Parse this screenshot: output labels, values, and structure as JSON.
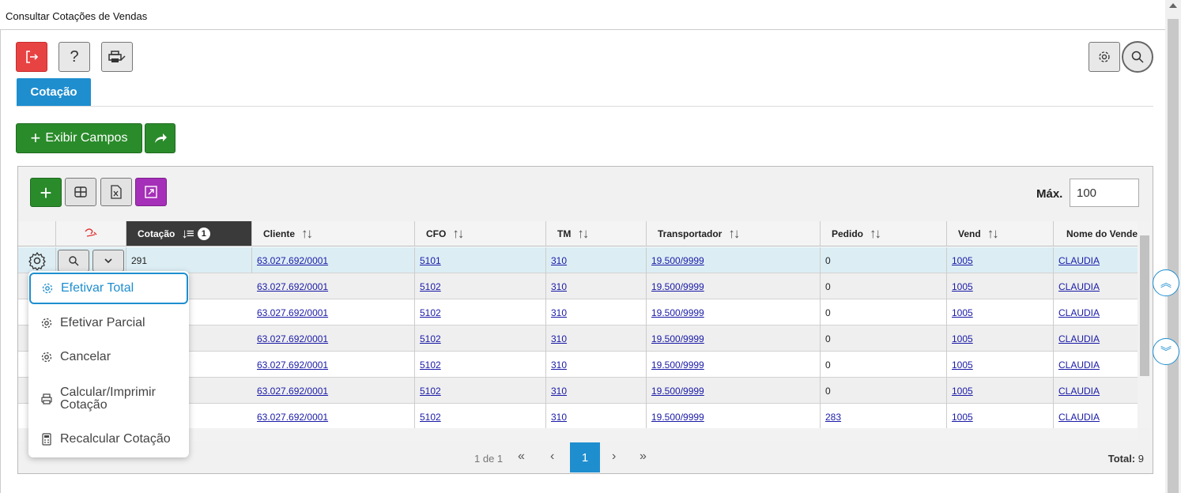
{
  "window": {
    "title": "Consultar Cotações de Vendas"
  },
  "toolbar": {
    "exit_icon": "logout-icon",
    "help_label": "?",
    "print_icon": "printer-icon",
    "settings_icon": "gear-icon",
    "search_icon": "search-icon"
  },
  "tabs": [
    {
      "label": "Cotação"
    }
  ],
  "actions": {
    "exibir_campos_label": "Exibir Campos",
    "share_icon": "share-icon"
  },
  "grid_toolbar": {
    "add_icon": "plus-icon",
    "columns_icon": "grid-icon",
    "excel_icon": "excel-icon",
    "expand_icon": "expand-icon",
    "max_label": "Máx.",
    "max_value": "100"
  },
  "table": {
    "columns": [
      {
        "label": "Cotação",
        "sort": "↓≡",
        "badge": "1"
      },
      {
        "label": "Cliente",
        "sort": "↑↓"
      },
      {
        "label": "CFO",
        "sort": "↑↓"
      },
      {
        "label": "TM",
        "sort": "↑↓"
      },
      {
        "label": "Transportador",
        "sort": "↑↓"
      },
      {
        "label": "Pedido",
        "sort": "↑↓"
      },
      {
        "label": "Vend",
        "sort": "↑↓"
      },
      {
        "label": "Nome do Vendedor",
        "sort": ""
      }
    ],
    "rows": [
      {
        "cotacao": "291",
        "cliente": "63.027.692/0001",
        "cfo": "5101",
        "tm": "310",
        "transportador": "19.500/9999",
        "pedido": "0",
        "vend": "1005",
        "nome": "CLAUDIA"
      },
      {
        "cotacao": "",
        "cliente": "63.027.692/0001",
        "cfo": "5102",
        "tm": "310",
        "transportador": "19.500/9999",
        "pedido": "0",
        "vend": "1005",
        "nome": "CLAUDIA"
      },
      {
        "cotacao": "",
        "cliente": "63.027.692/0001",
        "cfo": "5102",
        "tm": "310",
        "transportador": "19.500/9999",
        "pedido": "0",
        "vend": "1005",
        "nome": "CLAUDIA"
      },
      {
        "cotacao": "",
        "cliente": "63.027.692/0001",
        "cfo": "5102",
        "tm": "310",
        "transportador": "19.500/9999",
        "pedido": "0",
        "vend": "1005",
        "nome": "CLAUDIA"
      },
      {
        "cotacao": "",
        "cliente": "63.027.692/0001",
        "cfo": "5102",
        "tm": "310",
        "transportador": "19.500/9999",
        "pedido": "0",
        "vend": "1005",
        "nome": "CLAUDIA"
      },
      {
        "cotacao": "",
        "cliente": "63.027.692/0001",
        "cfo": "5102",
        "tm": "310",
        "transportador": "19.500/9999",
        "pedido": "0",
        "vend": "1005",
        "nome": "CLAUDIA"
      },
      {
        "cotacao": "",
        "cliente": "63.027.692/0001",
        "cfo": "5102",
        "tm": "310",
        "transportador": "19.500/9999",
        "pedido": "283",
        "vend": "1005",
        "nome": "CLAUDIA"
      }
    ]
  },
  "context_menu": {
    "items": [
      {
        "label": "Efetivar Total",
        "icon": "gear-icon"
      },
      {
        "label": "Efetivar Parcial",
        "icon": "gear-icon"
      },
      {
        "label": "Cancelar",
        "icon": "gear-icon"
      },
      {
        "label": "Calcular/Imprimir Cotação",
        "icon": "printer-icon"
      },
      {
        "label": "Recalcular Cotação",
        "icon": "calculator-icon"
      }
    ]
  },
  "pager": {
    "info": "1 de 1",
    "first": "«",
    "prev": "‹",
    "current": "1",
    "next": "›",
    "last": "»",
    "total_label": "Total:",
    "total_value": "9"
  },
  "colors": {
    "accent": "#1e8ecf",
    "green": "#2a8b2a",
    "red": "#e84343",
    "purple": "#a52fb8"
  }
}
